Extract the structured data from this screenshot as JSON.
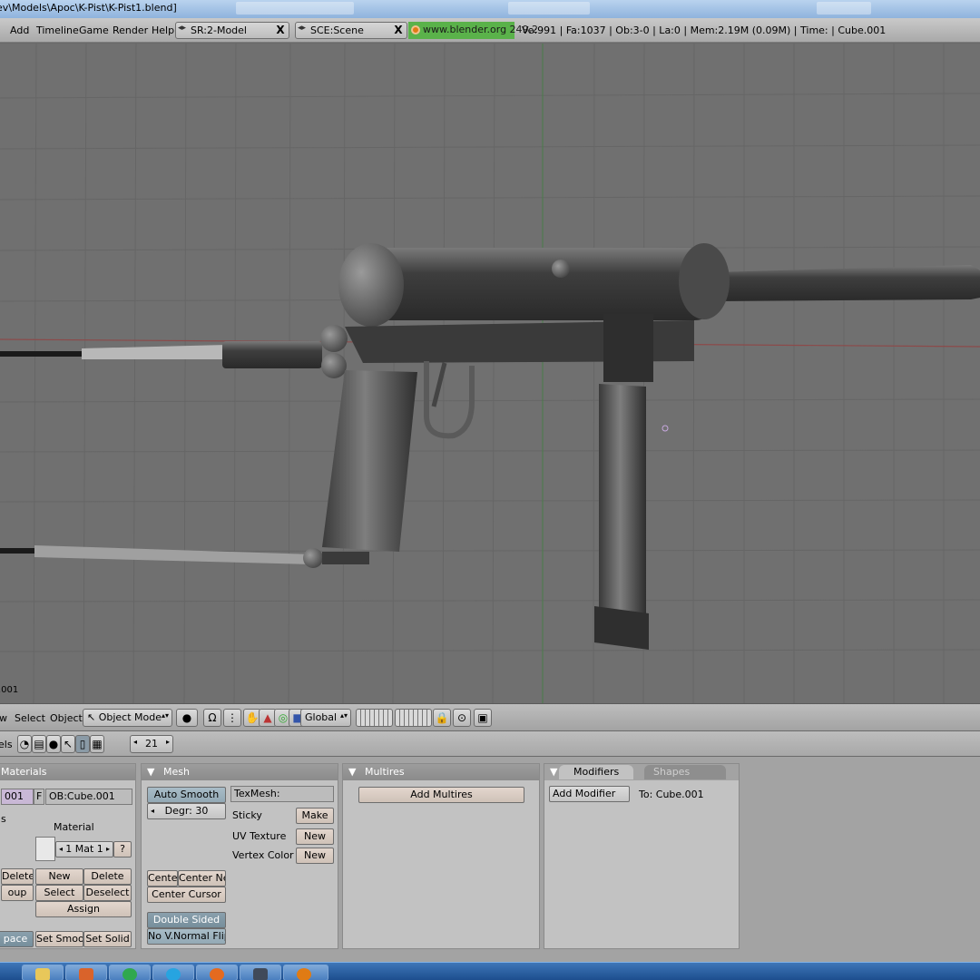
{
  "window": {
    "title": "ev\\Models\\Apoc\\K-Pist\\K-Pist1.blend]"
  },
  "info_header": {
    "menus": [
      "Add",
      "Timeline",
      "Game",
      "Render",
      "Help"
    ],
    "screen_field": "SR:2-Model",
    "scene_field": "SCE:Scene",
    "close_glyph": "X",
    "website": "www.blender.org 249.2",
    "stats": "Ve:991 | Fa:1037 | Ob:3-0 | La:0  | Mem:2.19M (0.09M)  | Time: | Cube.001"
  },
  "viewport": {
    "object_name": ".001",
    "colors": {
      "background": "#707070",
      "grid": "#666666",
      "x_axis": "#8c4a4a",
      "y_axis": "#4f7a4f"
    }
  },
  "view3d_header": {
    "menus": [
      "w",
      "Select",
      "Object"
    ],
    "mode": "Object Mode",
    "orientation": "Global"
  },
  "buttons_header": {
    "label": "els",
    "frame": "21"
  },
  "panels": {
    "materials": {
      "title": "Materials",
      "me_field": "001",
      "f_label": "F",
      "ob_field": "OB:Cube.001",
      "s_label": "s",
      "material_label": "Material",
      "mat_counter": "1 Mat 1",
      "question": "?",
      "delete_left": "Delete",
      "group_left": "oup",
      "new": "New",
      "delete": "Delete",
      "select": "Select",
      "deselect": "Deselect",
      "assign": "Assign",
      "space": "pace",
      "set_smooth": "Set Smooth",
      "set_solid": "Set Solid"
    },
    "mesh": {
      "title": "Mesh",
      "auto_smooth": "Auto Smooth",
      "degr": "Degr: 30",
      "texmesh": "TexMesh:",
      "sticky": "Sticky",
      "make": "Make",
      "uv_texture": "UV Texture",
      "vertex_color": "Vertex Color",
      "new": "New",
      "center": "Center",
      "center_new": "Center New",
      "center_cursor": "Center Cursor",
      "double_sided": "Double Sided",
      "no_vnormal_flip": "No V.Normal Flip"
    },
    "multires": {
      "title": "Multires",
      "add_multires": "Add Multires"
    },
    "modifiers": {
      "tab_modifiers": "Modifiers",
      "tab_shapes": "Shapes",
      "add_modifier": "Add Modifier",
      "to": "To: Cube.001"
    }
  },
  "colors": {
    "website_green": "#5ab24a",
    "panel_bg": "#c2c2c2",
    "button_salmon": "#e3d6cd",
    "button_active": "#8aa0ad",
    "taskbar": "#2a5ea1"
  }
}
